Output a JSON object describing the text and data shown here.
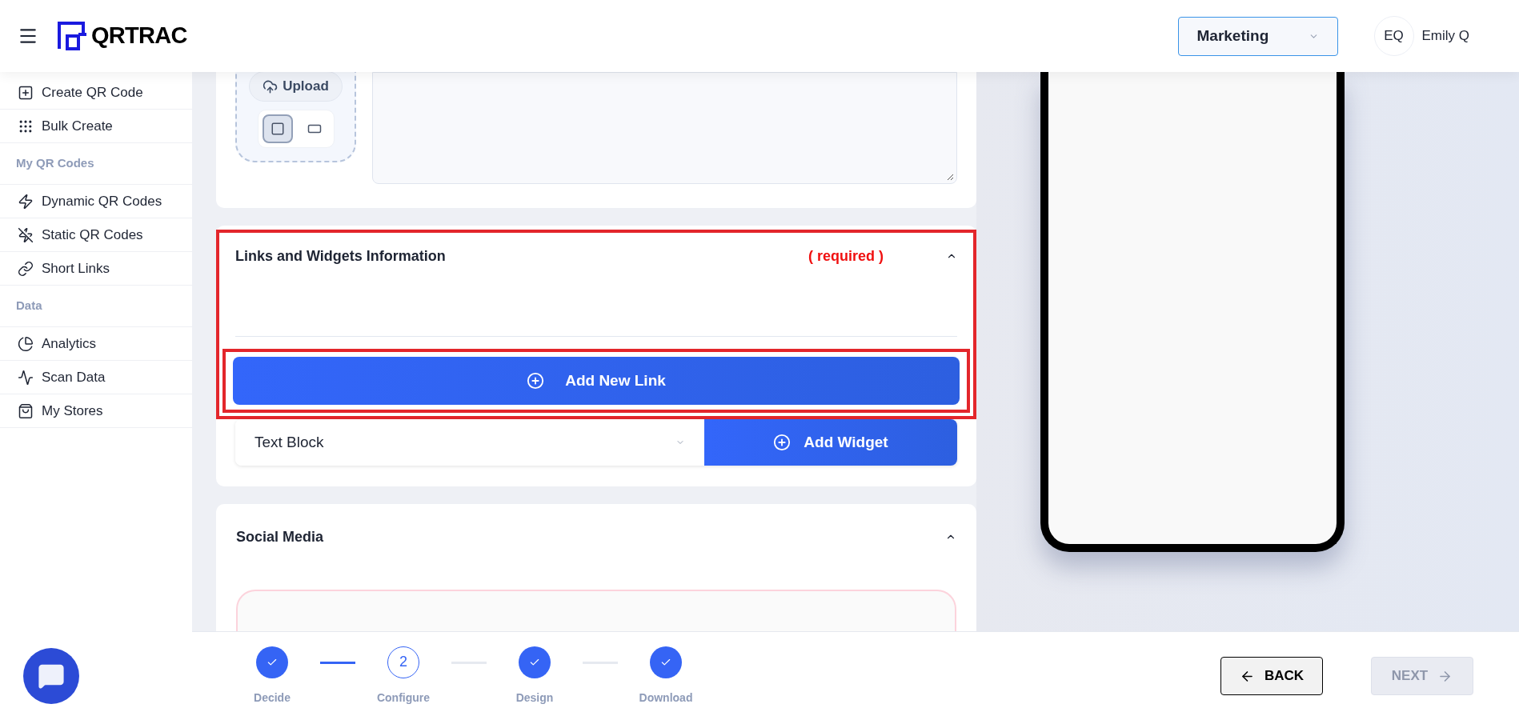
{
  "header": {
    "brand": "QRTRAC",
    "workspace": "Marketing",
    "user": {
      "initials": "EQ",
      "name": "Emily Q"
    }
  },
  "sidebar": {
    "items": [
      {
        "kind": "item",
        "label": "Create QR Code"
      },
      {
        "kind": "item",
        "label": "Bulk Create"
      },
      {
        "kind": "heading",
        "label": "My QR Codes"
      },
      {
        "kind": "item",
        "label": "Dynamic QR Codes"
      },
      {
        "kind": "item",
        "label": "Static QR Codes"
      },
      {
        "kind": "item",
        "label": "Short Links"
      },
      {
        "kind": "heading",
        "label": "Data"
      },
      {
        "kind": "item",
        "label": "Analytics"
      },
      {
        "kind": "item",
        "label": "Scan Data"
      },
      {
        "kind": "item",
        "label": "My Stores"
      }
    ]
  },
  "image_card": {
    "upload_button": "Upload",
    "shapes": [
      {
        "selected": true
      },
      {
        "selected": false
      }
    ]
  },
  "links_section": {
    "title": "Links and Widgets Information",
    "required": "( required )",
    "expanded": true,
    "highlighted": true,
    "add_link": {
      "label": "Add New Link",
      "highlighted": true
    },
    "widget_select": {
      "value": "Text Block"
    },
    "add_widget": "Add Widget"
  },
  "social_section": {
    "title": "Social Media",
    "expanded": true
  },
  "stepper": {
    "steps": [
      {
        "label": "Decide",
        "kind": "done"
      },
      {
        "label": "Configure",
        "kind": "current",
        "number": "2"
      },
      {
        "label": "Design",
        "kind": "done"
      },
      {
        "label": "Download",
        "kind": "done"
      }
    ]
  },
  "back_button": "BACK",
  "next_button": {
    "label": "NEXT",
    "disabled": true
  }
}
